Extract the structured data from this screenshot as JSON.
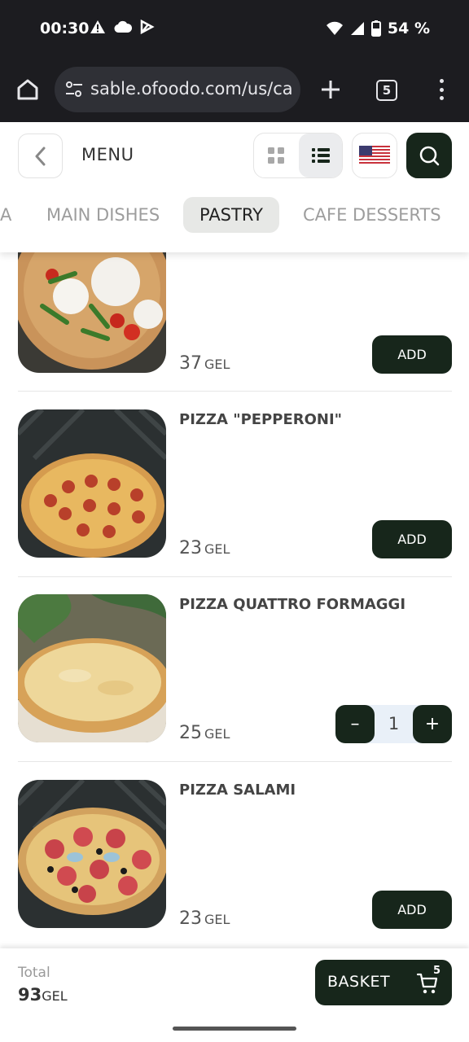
{
  "status": {
    "time": "00:30",
    "battery": "54 %"
  },
  "browser": {
    "url": "sable.ofoodo.com/us/ca",
    "tab_count": "5"
  },
  "header": {
    "title": "MENU",
    "active_view": "list"
  },
  "categories": [
    {
      "label": "A",
      "active": false
    },
    {
      "label": "MAIN DISHES",
      "active": false
    },
    {
      "label": "PASTRY",
      "active": true
    },
    {
      "label": "CAFE DESSERTS",
      "active": false
    }
  ],
  "items": [
    {
      "name": "",
      "price": "37",
      "currency": "GEL",
      "action": "ADD"
    },
    {
      "name": "PIZZA \"PEPPERONI\"",
      "price": "23",
      "currency": "GEL",
      "action": "ADD"
    },
    {
      "name": "PIZZA QUATTRO FORMAGGI",
      "price": "25",
      "currency": "GEL",
      "quantity": "1"
    },
    {
      "name": "PIZZA SALAMI",
      "price": "23",
      "currency": "GEL",
      "action": "ADD"
    }
  ],
  "footer": {
    "total_label": "Total",
    "total_value": "93",
    "total_currency": "GEL",
    "basket_label": "BASKET",
    "basket_count": "5"
  },
  "colors": {
    "primary": "#17261b",
    "status_bar": "#1c1c20"
  }
}
